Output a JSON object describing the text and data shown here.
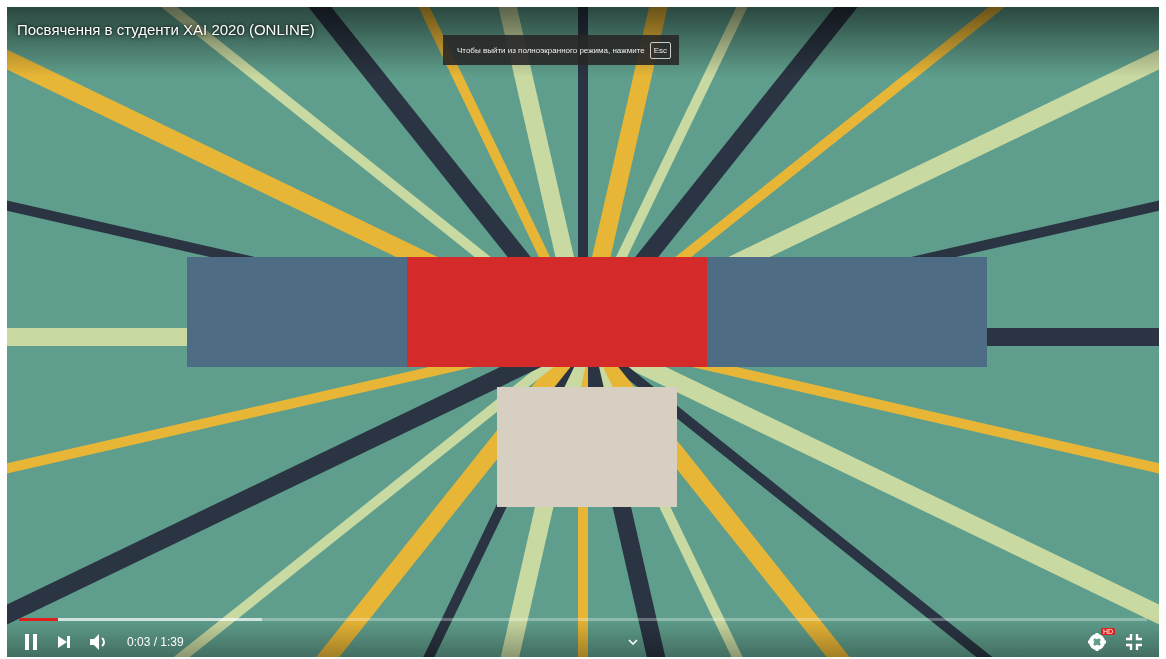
{
  "video": {
    "title": "Посвячення в студенти ХАІ 2020 (ONLINE)",
    "fullscreen_notice": {
      "text": "Чтобы выйти из полноэкранного режима, нажмите",
      "key": "Esc"
    }
  },
  "controls": {
    "progress": {
      "level": 0.035
    },
    "buffer": {
      "level": 0.215
    },
    "playing": true,
    "time": "0:03 / 1:39",
    "quality_badge": "HD"
  }
}
